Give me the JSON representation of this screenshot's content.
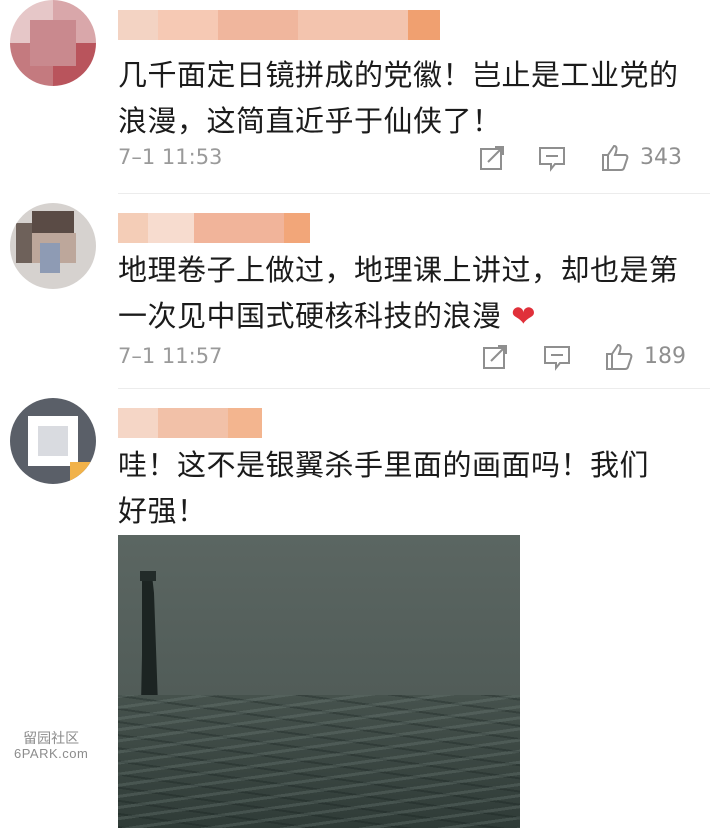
{
  "comments": [
    {
      "username_blurred": true,
      "text": "几千面定日镜拼成的党徽！岂止是工业党的浪漫，这简直近乎于仙侠了！",
      "timestamp": "7–1 11:53",
      "likes": "343",
      "icons": [
        "share-icon",
        "comment-icon",
        "like-icon"
      ]
    },
    {
      "username_blurred": true,
      "text": "地理卷子上做过，地理课上讲过，却也是第一次见中国式硬核科技的浪漫",
      "emoji": "❤",
      "timestamp": "7–1 11:57",
      "likes": "189",
      "icons": [
        "share-icon",
        "comment-icon",
        "like-icon"
      ]
    },
    {
      "username_blurred": true,
      "text": "哇！这不是银翼杀手里面的画面吗！我们好强！",
      "has_image": true
    }
  ],
  "watermark": {
    "line1": "留园社区",
    "line2": "6PARK.com"
  },
  "colors": {
    "text": "#1b1b1b",
    "meta": "#9a9a9a",
    "heart": "#e0303a",
    "divider": "#ececec"
  }
}
